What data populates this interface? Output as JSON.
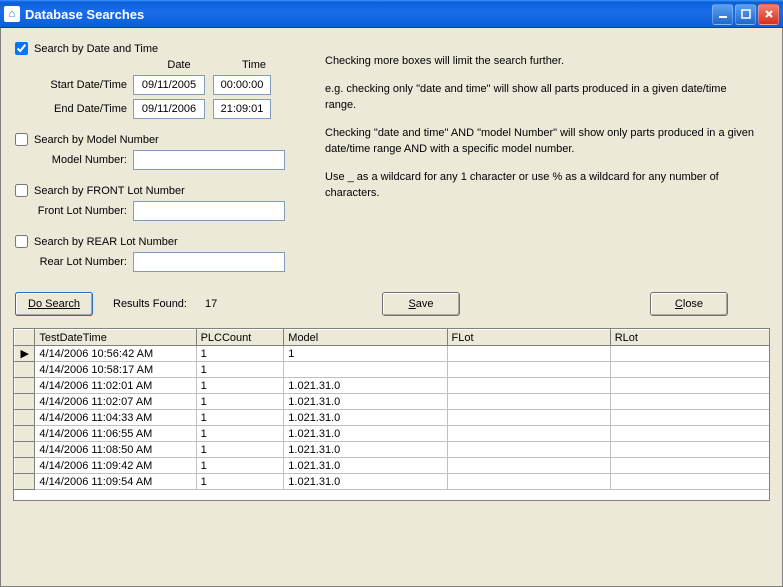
{
  "titlebar": {
    "icon": "⌂",
    "title": "Database Searches"
  },
  "search": {
    "by_date_time": {
      "label": "Search by Date and Time",
      "checked": true,
      "date_hdr": "Date",
      "time_hdr": "Time",
      "start_label": "Start Date/Time",
      "start_date": "09/11/2005",
      "start_time": "00:00:00",
      "end_label": "End Date/Time",
      "end_date": "09/11/2006",
      "end_time": "21:09:01"
    },
    "by_model": {
      "label": "Search by Model Number",
      "checked": false,
      "field_label": "Model Number:",
      "value": ""
    },
    "by_front_lot": {
      "label": "Search by FRONT Lot Number",
      "checked": false,
      "field_label": "Front Lot Number:",
      "value": ""
    },
    "by_rear_lot": {
      "label": "Search by REAR Lot Number",
      "checked": false,
      "field_label": "Rear Lot Number:",
      "value": ""
    }
  },
  "help": {
    "p1": "Checking more boxes will limit the search further.",
    "p2": "e.g. checking only \"date and time\" will show all parts produced in a given date/time range.",
    "p3": "Checking \"date and time\" AND \"model Number\" will show only parts produced in a given date/time range AND with a specific model number.",
    "p4": "Use _ as a wildcard for any 1 character or use % as a wildcard for any number of characters."
  },
  "buttons": {
    "do_search": "Do Search",
    "results_label": "Results Found:",
    "results_count": "17",
    "save_pre": "",
    "save_u": "S",
    "save_post": "ave",
    "close_pre": "",
    "close_u": "C",
    "close_post": "lose"
  },
  "grid": {
    "columns": [
      "TestDateTime",
      "PLCCount",
      "Model",
      "FLot",
      "RLot"
    ],
    "rows": [
      {
        "current": true,
        "cells": [
          "4/14/2006 10:56:42 AM",
          "1",
          "1",
          "",
          ""
        ]
      },
      {
        "current": false,
        "cells": [
          "4/14/2006 10:58:17 AM",
          "1",
          "",
          "",
          ""
        ]
      },
      {
        "current": false,
        "cells": [
          "4/14/2006 11:02:01 AM",
          "1",
          "1.021.31.0",
          "",
          ""
        ]
      },
      {
        "current": false,
        "cells": [
          "4/14/2006 11:02:07 AM",
          "1",
          "1.021.31.0",
          "",
          ""
        ]
      },
      {
        "current": false,
        "cells": [
          "4/14/2006 11:04:33 AM",
          "1",
          "1.021.31.0",
          "",
          ""
        ]
      },
      {
        "current": false,
        "cells": [
          "4/14/2006 11:06:55 AM",
          "1",
          "1.021.31.0",
          "",
          ""
        ]
      },
      {
        "current": false,
        "cells": [
          "4/14/2006 11:08:50 AM",
          "1",
          "1.021.31.0",
          "",
          ""
        ]
      },
      {
        "current": false,
        "cells": [
          "4/14/2006 11:09:42 AM",
          "1",
          "1.021.31.0",
          "",
          ""
        ]
      },
      {
        "current": false,
        "cells": [
          "4/14/2006 11:09:54 AM",
          "1",
          "1.021.31.0",
          "",
          ""
        ]
      }
    ]
  }
}
